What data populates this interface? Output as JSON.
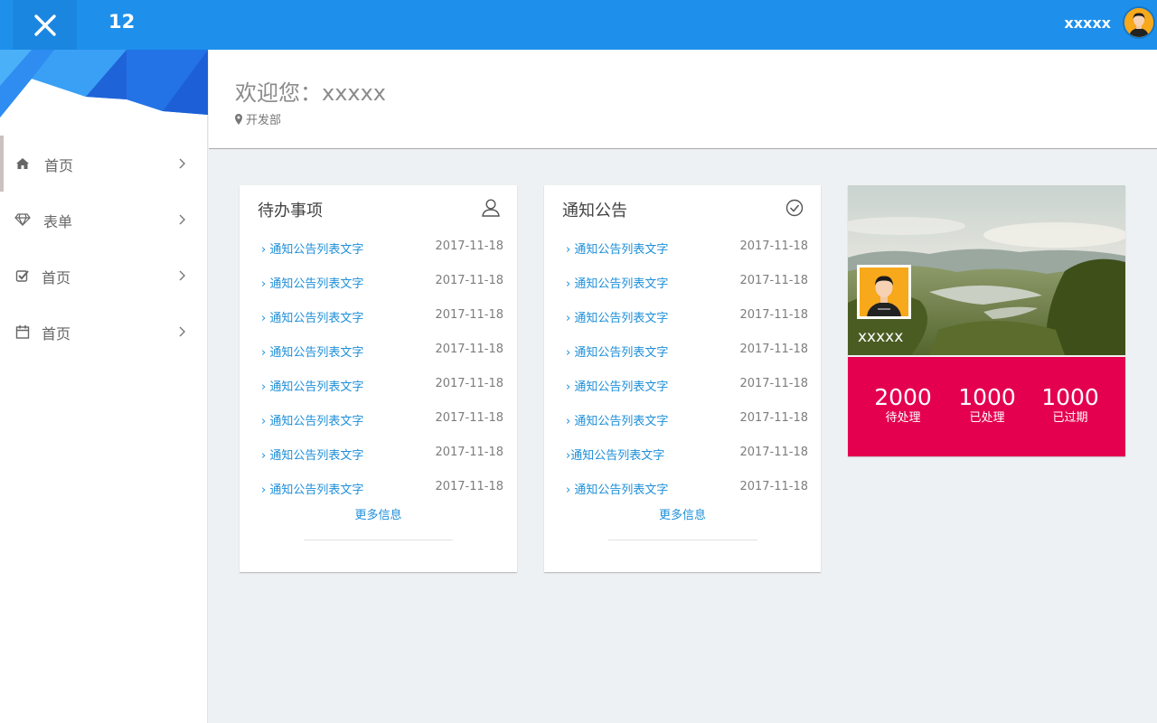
{
  "topbar": {
    "brand": "12",
    "user_name": "xxxxx",
    "close_icon": "close-icon",
    "bg_color": "#1e90ec"
  },
  "sidebar": {
    "items": [
      {
        "label": "首页",
        "icon": "home-icon",
        "active": true
      },
      {
        "label": "表单",
        "icon": "diamond-icon",
        "active": false
      },
      {
        "label": "首页",
        "icon": "check-square-icon",
        "active": false
      },
      {
        "label": "首页",
        "icon": "calendar-icon",
        "active": false
      }
    ]
  },
  "header": {
    "welcome": "欢迎您：xxxxx",
    "department": "开发部"
  },
  "todo": {
    "title": "待办事项",
    "icon": "user-icon",
    "items": [
      {
        "text": "通知公告列表文字",
        "date": "2017-11-18"
      },
      {
        "text": "通知公告列表文字",
        "date": "2017-11-18"
      },
      {
        "text": "通知公告列表文字",
        "date": "2017-11-18"
      },
      {
        "text": "通知公告列表文字",
        "date": "2017-11-18"
      },
      {
        "text": "通知公告列表文字",
        "date": "2017-11-18"
      },
      {
        "text": "通知公告列表文字",
        "date": "2017-11-18"
      },
      {
        "text": "通知公告列表文字",
        "date": "2017-11-18"
      },
      {
        "text": "通知公告列表文字",
        "date": "2017-11-18"
      }
    ],
    "more": "更多信息"
  },
  "notice": {
    "title": "通知公告",
    "icon": "check-circle-icon",
    "items": [
      {
        "text": "通知公告列表文字",
        "date": "2017-11-18"
      },
      {
        "text": "通知公告列表文字",
        "date": "2017-11-18"
      },
      {
        "text": "通知公告列表文字",
        "date": "2017-11-18"
      },
      {
        "text": "通知公告列表文字",
        "date": "2017-11-18"
      },
      {
        "text": "通知公告列表文字",
        "date": "2017-11-18"
      },
      {
        "text": "通知公告列表文字",
        "date": "2017-11-18"
      },
      {
        "text": "通知公告列表文字",
        "date": "2017-11-18"
      },
      {
        "text": "通知公告列表文字",
        "date": "2017-11-18"
      }
    ],
    "more": "更多信息"
  },
  "profile": {
    "name": "xxxxx",
    "accent": "#e4004f",
    "stats": [
      {
        "value": "2000",
        "label": "待处理"
      },
      {
        "value": "1000",
        "label": "已处理"
      },
      {
        "value": "1000",
        "label": "已过期"
      }
    ]
  }
}
